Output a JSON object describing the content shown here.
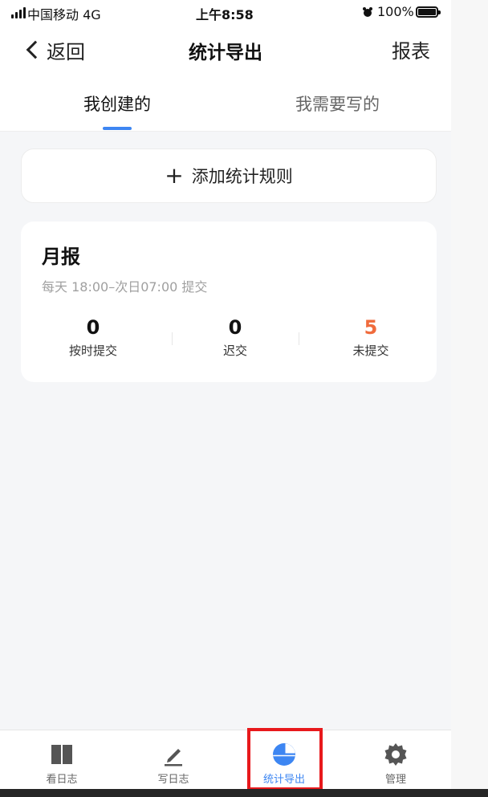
{
  "status_bar": {
    "carrier": "中国移动  4G",
    "time": "上午8:58",
    "battery": "100%"
  },
  "nav": {
    "back_label": "返回",
    "title": "统计导出",
    "right_action": "报表"
  },
  "tabs": [
    {
      "label": "我创建的",
      "active": true
    },
    {
      "label": "我需要写的",
      "active": false
    }
  ],
  "add_rule": {
    "plus": "+",
    "label": "添加统计规则"
  },
  "report_card": {
    "title": "月报",
    "schedule": "每天 18:00–次日07:00 提交",
    "stats": [
      {
        "value": "0",
        "label": "按时提交"
      },
      {
        "value": "0",
        "label": "迟交"
      },
      {
        "value": "5",
        "label": "未提交"
      }
    ]
  },
  "tab_bar": [
    {
      "label": "看日志",
      "icon": "book-icon",
      "active": false
    },
    {
      "label": "写日志",
      "icon": "pen-icon",
      "active": false
    },
    {
      "label": "统计导出",
      "icon": "pie-chart-icon",
      "active": true
    },
    {
      "label": "管理",
      "icon": "gear-icon",
      "active": false
    }
  ],
  "colors": {
    "accent": "#3d86f2",
    "highlight": "#f06b3c",
    "annotation_box": "#e8191c"
  }
}
